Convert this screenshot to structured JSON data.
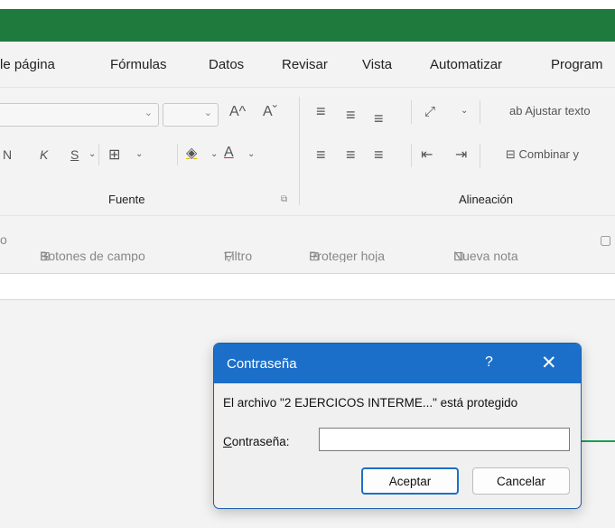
{
  "menu": {
    "items": [
      "le página",
      "Fórmulas",
      "Datos",
      "Revisar",
      "Vista",
      "Automatizar",
      "Program"
    ]
  },
  "ribbon": {
    "font_group_label": "Fuente",
    "align_group_label": "Alineación",
    "font_grow": "A^",
    "font_shrink": "Aˇ",
    "italic": "K",
    "strike": "S",
    "bold_partial": "N",
    "wrap_text": "Ajustar texto",
    "merge": "Combinar y"
  },
  "protect_bar": {
    "items": [
      "Botones de campo",
      "Filtro",
      "Proteger hoja",
      "Nueva nota"
    ],
    "leading_fragment": "o"
  },
  "dialog": {
    "title": "Contraseña",
    "help": "?",
    "close": "✕",
    "message": "El archivo \"2 EJERCICOS INTERME...\" está protegido",
    "password_label_first": "C",
    "password_label_rest": "ontraseña:",
    "password_value": "",
    "ok_label": "Aceptar",
    "cancel_label": "Cancelar"
  },
  "colors": {
    "excel_green": "#1e7a3d",
    "dialog_blue": "#1c6fc9",
    "connector_green": "#1aa052"
  }
}
